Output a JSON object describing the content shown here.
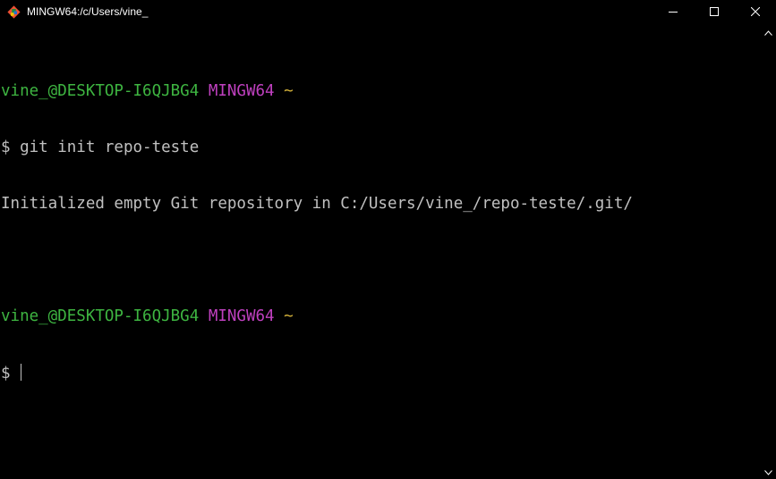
{
  "window": {
    "title": "MINGW64:/c/Users/vine_",
    "icon": "git-bash-icon",
    "controls": {
      "minimize_icon": "minimize-icon",
      "maximize_icon": "maximize-icon",
      "close_icon": "close-icon"
    }
  },
  "colors": {
    "user_host": "#3eb541",
    "system": "#bf40bf",
    "path": "#d7b43a",
    "text": "#c0c0c0",
    "background": "#000000"
  },
  "terminal": {
    "prompt1": {
      "user_host": "vine_@DESKTOP-I6QJBG4",
      "system": "MINGW64",
      "path": "~"
    },
    "command1": "$ git init repo-teste",
    "output1": "Initialized empty Git repository in C:/Users/vine_/repo-teste/.git/",
    "prompt2": {
      "user_host": "vine_@DESKTOP-I6QJBG4",
      "system": "MINGW64",
      "path": "~"
    },
    "command2": "$ "
  }
}
